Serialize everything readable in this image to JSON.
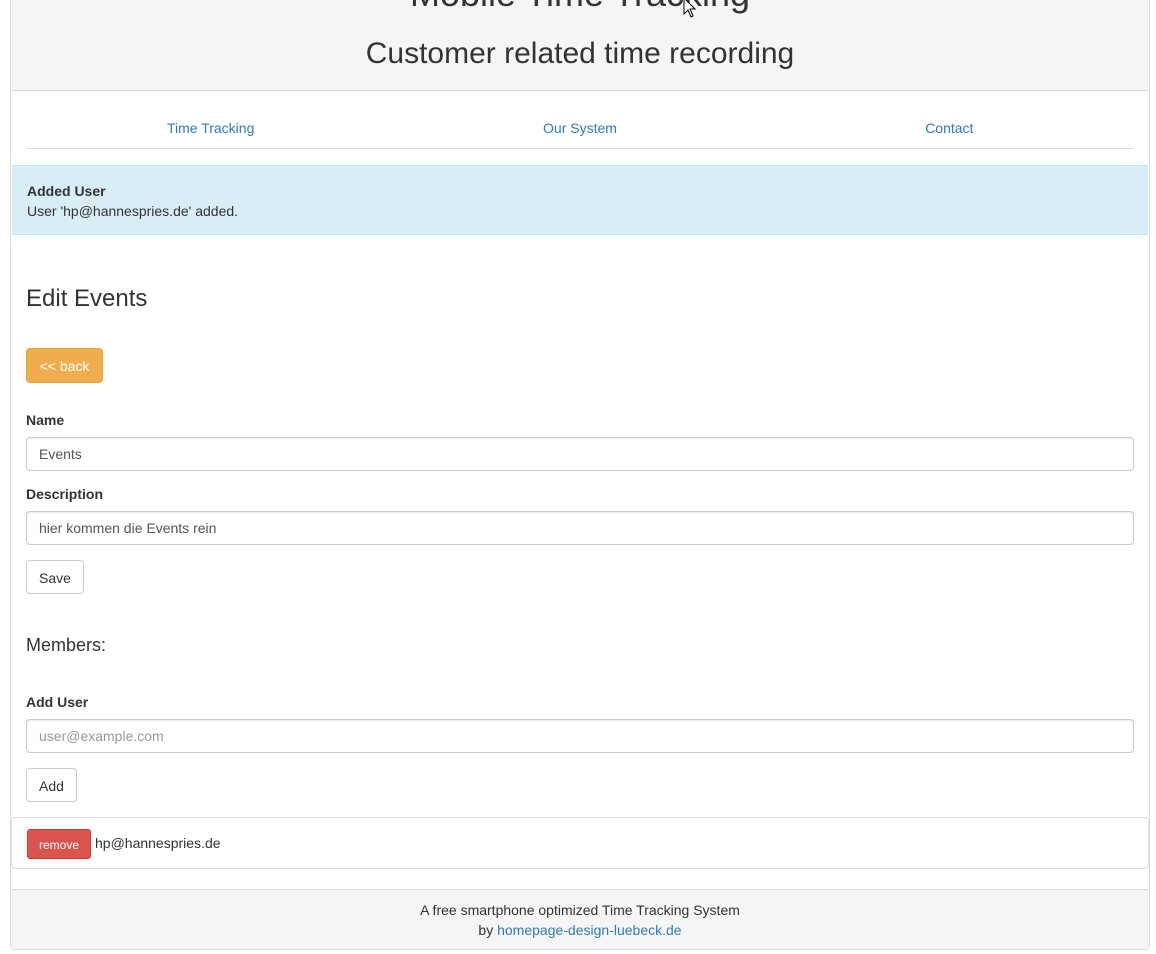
{
  "header": {
    "title": "Mobile Time Tracking",
    "subtitle": "Customer related time recording"
  },
  "nav": {
    "items": [
      {
        "label": "Time Tracking"
      },
      {
        "label": "Our System"
      },
      {
        "label": "Contact"
      }
    ]
  },
  "alert": {
    "title": "Added User",
    "message": "User 'hp@hannespries.de' added."
  },
  "page": {
    "title": "Edit Events",
    "back_label": "<< back"
  },
  "form": {
    "name_label": "Name",
    "name_value": "Events",
    "description_label": "Description",
    "description_value": "hier kommen die Events rein",
    "save_label": "Save"
  },
  "members": {
    "title": "Members:",
    "add_user_label": "Add User",
    "add_user_placeholder": "user@example.com",
    "add_label": "Add",
    "list": [
      {
        "remove_label": "remove",
        "email": "hp@hannespries.de"
      }
    ]
  },
  "footer": {
    "line1": "A free smartphone optimized Time Tracking System",
    "by_text": "by",
    "link_text": "homepage-design-luebeck.de"
  },
  "colors": {
    "link": "#337ab7",
    "warning_button": "#f0ad4e",
    "danger_button": "#d9534f",
    "alert_background": "#d9edf7",
    "panel_background": "#f5f5f5"
  }
}
